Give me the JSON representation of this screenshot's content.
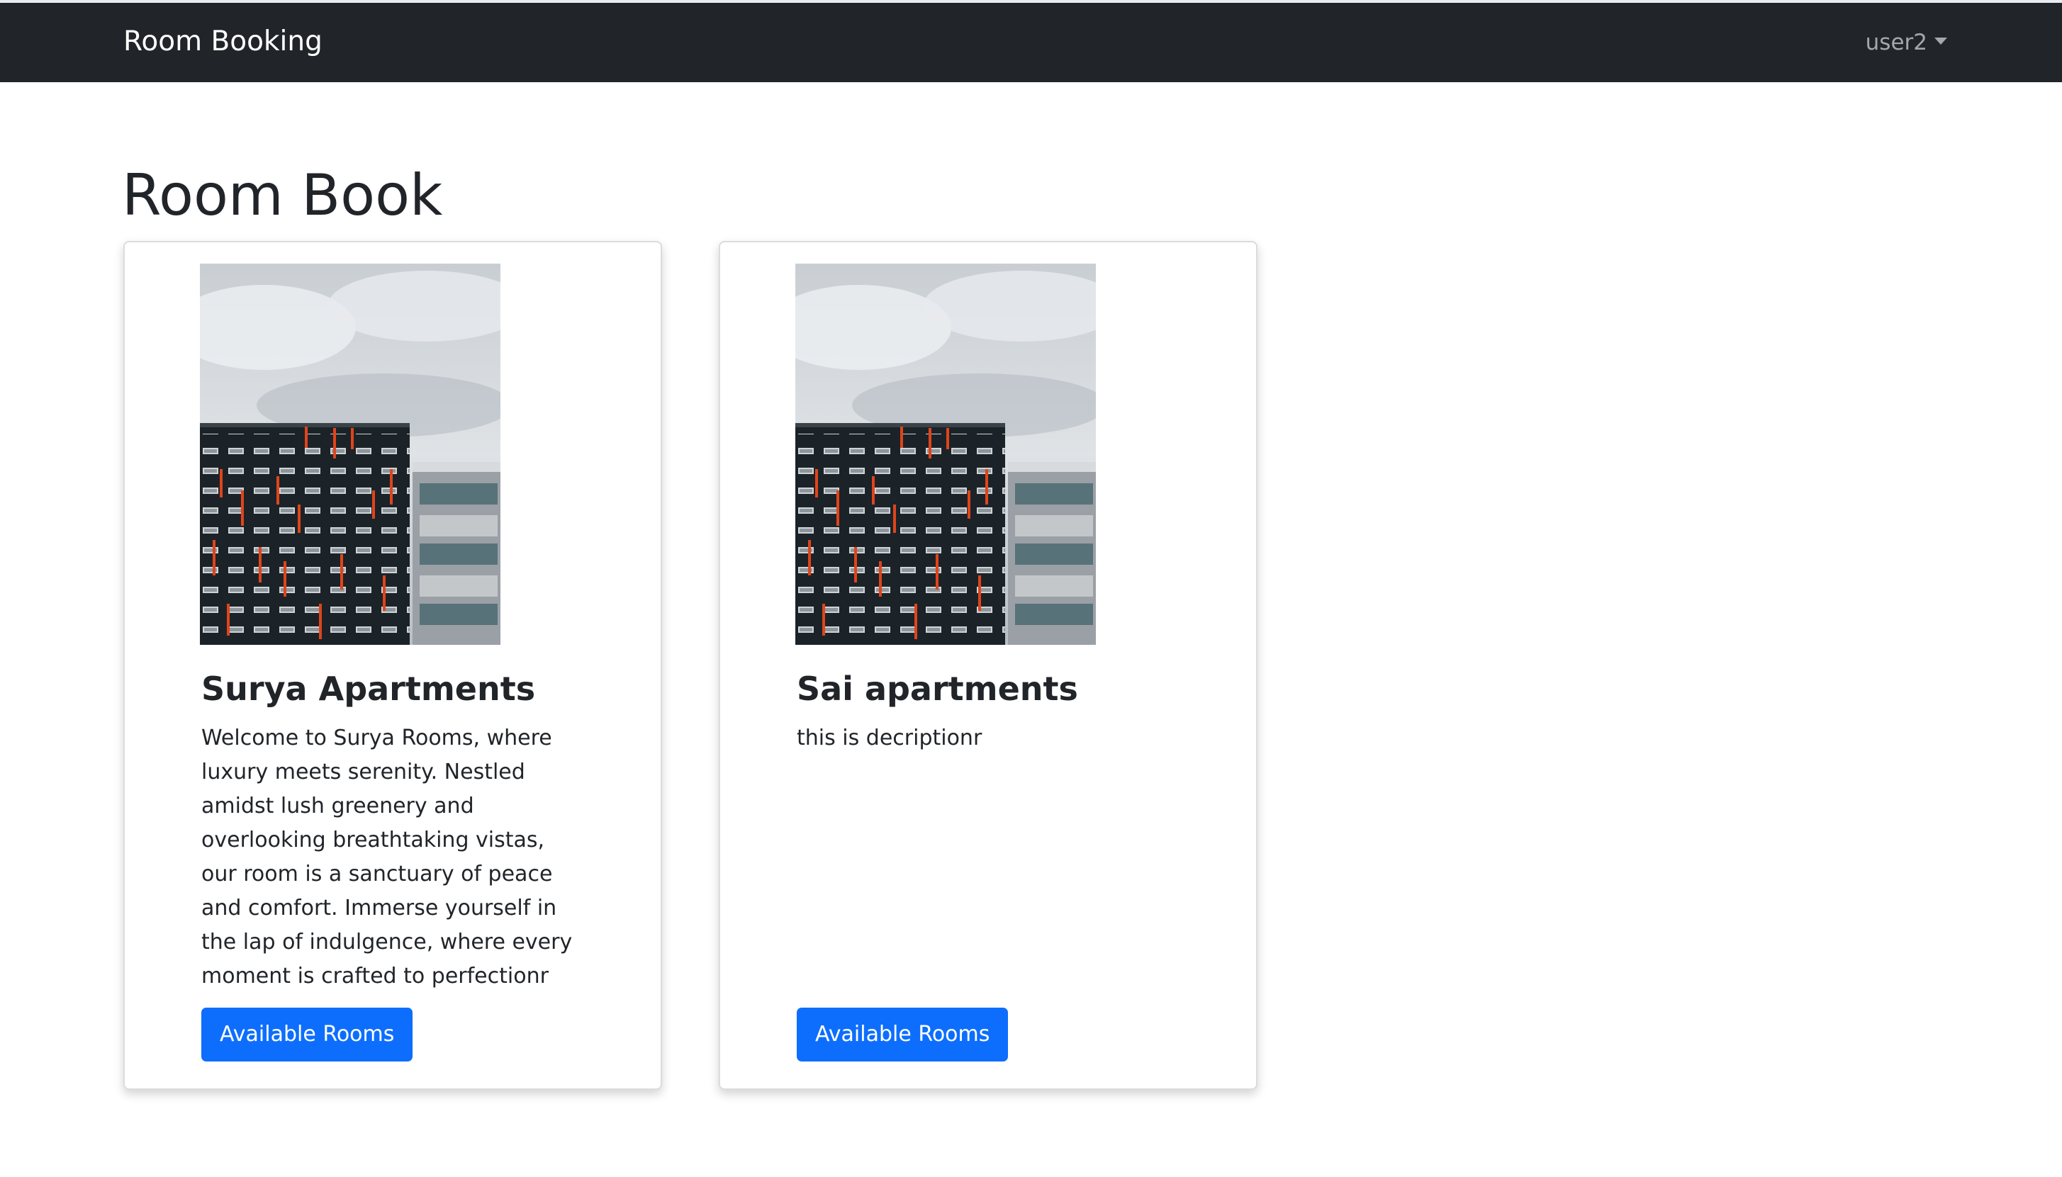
{
  "navbar": {
    "brand": "Room Booking",
    "user": "user2",
    "colors": {
      "background": "#212529",
      "brand_text": "#ffffff"
    }
  },
  "page": {
    "title": "Room Book"
  },
  "cards": [
    {
      "title": "Surya Apartments",
      "description": "Welcome to Surya Rooms, where luxury meets serenity. Nestled amidst lush greenery and overlooking breathtaking vistas, our room is a sanctuary of peace and comfort. Immerse yourself in the lap of indulgence, where every moment is crafted to perfectionr",
      "button_label": "Available Rooms",
      "image_icon": "building-photo"
    },
    {
      "title": "Sai apartments",
      "description": "this is decriptionr",
      "button_label": "Available Rooms",
      "image_icon": "building-photo"
    }
  ],
  "colors": {
    "primary_button": "#0d6efd",
    "text": "#212529"
  }
}
